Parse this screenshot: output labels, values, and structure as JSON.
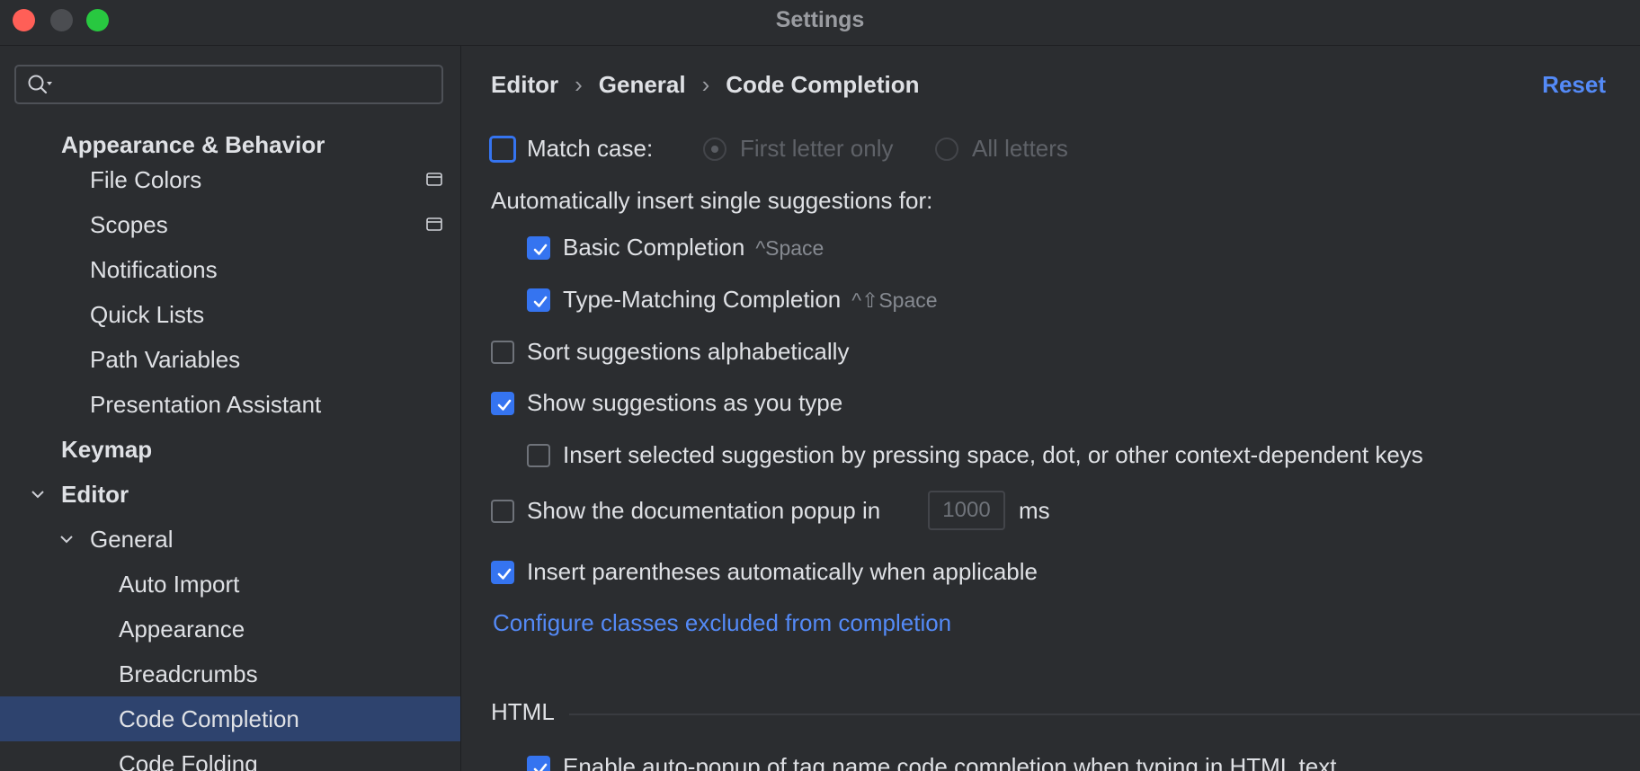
{
  "window": {
    "title": "Settings"
  },
  "sidebar": {
    "search": {
      "value": "",
      "placeholder": ""
    },
    "items": [
      {
        "label": "Appearance & Behavior"
      },
      {
        "label": "File Colors"
      },
      {
        "label": "Scopes"
      },
      {
        "label": "Notifications"
      },
      {
        "label": "Quick Lists"
      },
      {
        "label": "Path Variables"
      },
      {
        "label": "Presentation Assistant"
      },
      {
        "label": "Keymap"
      },
      {
        "label": "Editor"
      },
      {
        "label": "General"
      },
      {
        "label": "Auto Import"
      },
      {
        "label": "Appearance"
      },
      {
        "label": "Breadcrumbs"
      },
      {
        "label": "Code Completion",
        "selected": true
      },
      {
        "label": "Code Folding"
      }
    ]
  },
  "main": {
    "breadcrumbs": [
      "Editor",
      "General",
      "Code Completion"
    ],
    "reset_label": "Reset",
    "match_case": {
      "label": "Match case:",
      "checked": false,
      "options": [
        "First letter only",
        "All letters"
      ]
    },
    "auto_insert_heading": "Automatically insert single suggestions for:",
    "basic_completion": {
      "label": "Basic Completion",
      "shortcut": "^Space",
      "checked": true
    },
    "type_matching": {
      "label": "Type-Matching Completion",
      "shortcut": "^⇧Space",
      "checked": true
    },
    "sort_alpha": {
      "label": "Sort suggestions alphabetically",
      "checked": false
    },
    "show_as_type": {
      "label": "Show suggestions as you type",
      "checked": true
    },
    "insert_selected": {
      "label": "Insert selected suggestion by pressing space, dot, or other context-dependent keys",
      "checked": false
    },
    "doc_popup": {
      "label": "Show the documentation popup in",
      "value": "1000",
      "unit": "ms",
      "checked": false
    },
    "insert_parens": {
      "label": "Insert parentheses automatically when applicable",
      "checked": true
    },
    "configure_link": "Configure classes excluded from completion",
    "html_section": {
      "title": "HTML",
      "auto_popup": {
        "label": "Enable auto-popup of tag name code completion when typing in HTML text",
        "checked": true
      }
    }
  },
  "colors": {
    "accent": "#3574f0",
    "link": "#548af7",
    "selection": "#2e436e",
    "background": "#2b2d30"
  }
}
